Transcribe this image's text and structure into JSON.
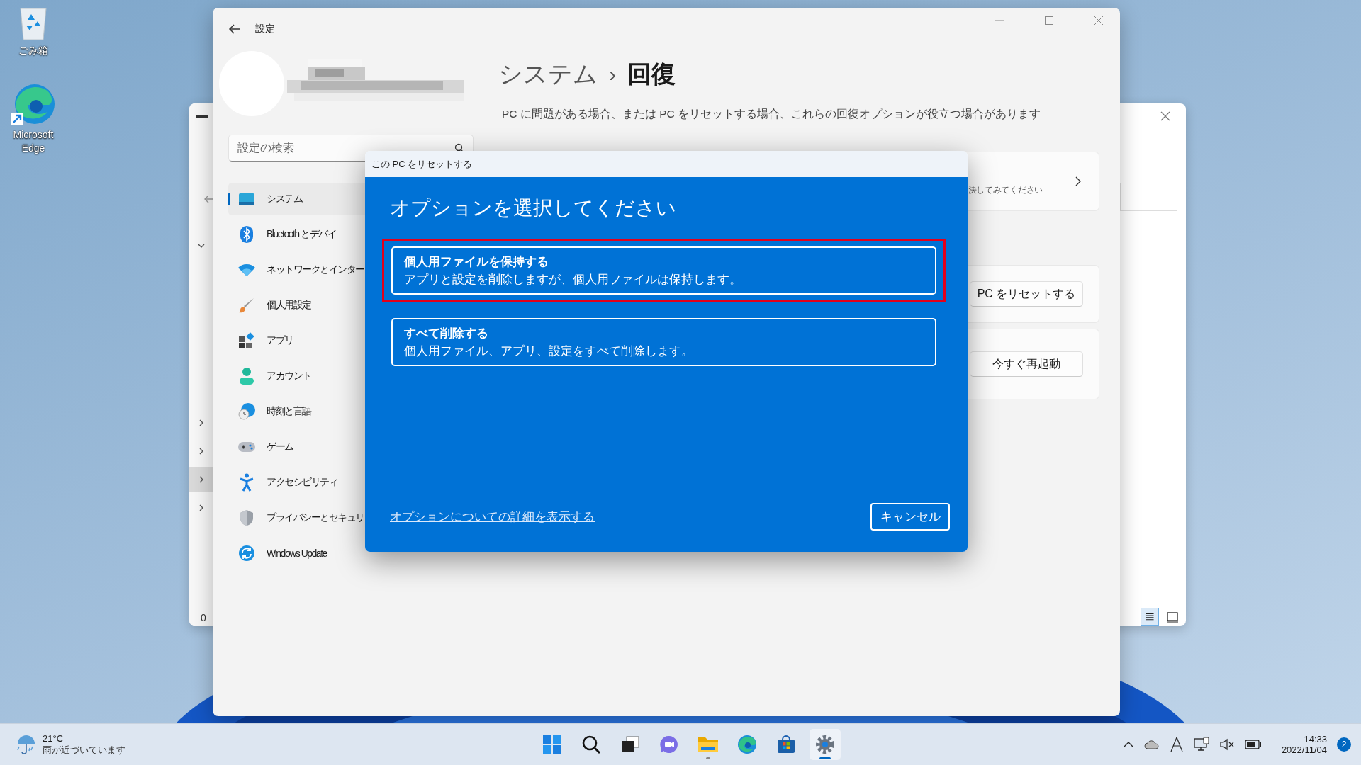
{
  "desktop_icons": [
    {
      "label": "ごみ箱"
    },
    {
      "label": "Microsoft Edge"
    }
  ],
  "background_window": {
    "tree_rows": [
      {
        "expanded": true,
        "selected": false
      },
      {
        "expanded": false,
        "selected": false
      },
      {
        "expanded": false,
        "selected": false
      },
      {
        "expanded": false,
        "selected": true
      },
      {
        "expanded": false,
        "selected": false
      }
    ],
    "status_text": "0"
  },
  "settings": {
    "title": "設定",
    "search": {
      "placeholder": "設定の検索"
    },
    "nav": [
      {
        "label": "システム",
        "selected": true
      },
      {
        "label": "Bluetooth とデバイ",
        "selected": false
      },
      {
        "label": "ネットワークとインター",
        "selected": false
      },
      {
        "label": "個人用設定",
        "selected": false
      },
      {
        "label": "アプリ",
        "selected": false
      },
      {
        "label": "アカウント",
        "selected": false
      },
      {
        "label": "時刻と言語",
        "selected": false
      },
      {
        "label": "ゲーム",
        "selected": false
      },
      {
        "label": "アクセシビリティ",
        "selected": false
      },
      {
        "label": "プライバシーとセキュリ",
        "selected": false
      },
      {
        "label": "Windows Update",
        "selected": false
      }
    ],
    "breadcrumb": {
      "parent": "システム",
      "separator": "›",
      "current": "回復"
    },
    "description": "PC に問題がある場合、または PC をリセットする場合、これらの回復オプションが役立つ場合があります",
    "cards": [
      {
        "kind": "link",
        "text": "決してみてください"
      },
      {
        "kind": "button",
        "button": "PC をリセットする"
      },
      {
        "kind": "button",
        "button": "今すぐ再起動"
      }
    ]
  },
  "dialog": {
    "title": "この PC をリセットする",
    "heading": "オプションを選択してください",
    "options": [
      {
        "title": "個人用ファイルを保持する",
        "description": "アプリと設定を削除しますが、個人用ファイルは保持します。",
        "selected": true
      },
      {
        "title": "すべて削除する",
        "description": "個人用ファイル、アプリ、設定をすべて削除します。",
        "selected": false
      }
    ],
    "link": "オプションについての詳細を表示する",
    "cancel": "キャンセル"
  },
  "taskbar": {
    "weather": {
      "temperature": "21°C",
      "forecast": "雨が近づいています"
    },
    "apps": [
      {
        "selected": false,
        "running": false
      },
      {
        "selected": false,
        "running": false
      },
      {
        "selected": false,
        "running": false
      },
      {
        "selected": false,
        "running": false
      },
      {
        "selected": false,
        "running": true
      },
      {
        "selected": false,
        "running": false
      },
      {
        "selected": false,
        "running": false
      },
      {
        "selected": true,
        "running": true
      }
    ],
    "time": "14:33",
    "date": "2022/11/04",
    "notifications": "2"
  }
}
